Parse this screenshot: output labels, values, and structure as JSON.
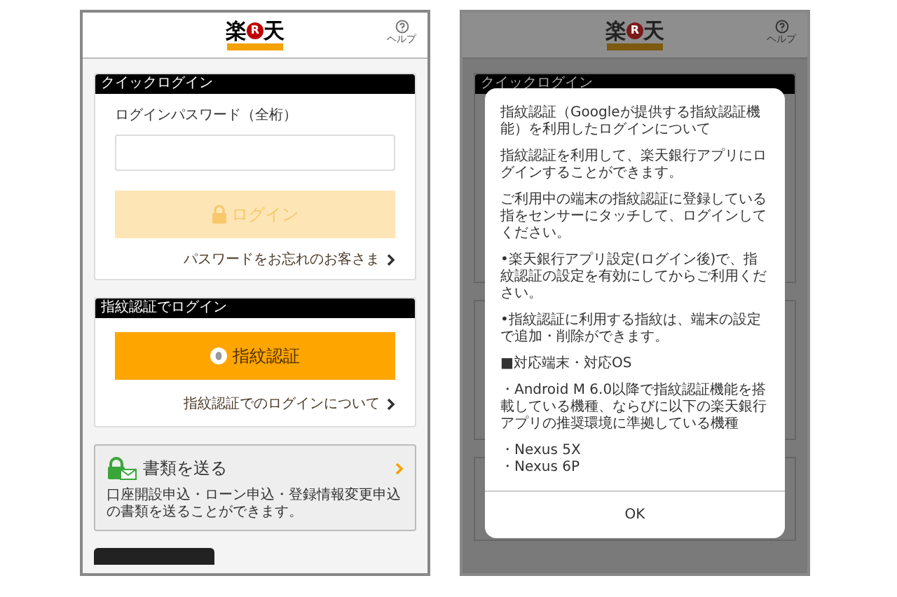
{
  "screens": [
    {
      "kind": "main",
      "header": {
        "logo_left": "楽",
        "logo_mark": "R",
        "logo_right": "天",
        "help": "ヘルプ"
      },
      "sections": [
        {
          "kind": "password",
          "heading": "クイックログイン",
          "label": "ログインパスワード（全桁）",
          "button": {
            "label": "ログイン",
            "disabled": true
          },
          "link": "パスワードをお忘れのお客さま"
        },
        {
          "kind": "fingerprint",
          "heading": "指紋認証でログイン",
          "button": {
            "label": "指紋認証",
            "disabled": false
          },
          "link": "指紋認証でのログインについて"
        },
        {
          "kind": "documents",
          "title": "書類を送る",
          "description": "口座開設申込・ローン申込・登録情報変更申込の書類を送ることができます。"
        },
        {
          "kind": "cut_heading"
        }
      ]
    },
    {
      "kind": "dialog",
      "header": {
        "logo_left": "楽",
        "logo_mark": "R",
        "logo_right": "天",
        "help": "ヘルプ"
      },
      "heading": "クイックログイン",
      "dialog": {
        "paragraphs": [
          "指紋認証（Googleが提供する指紋認証機能）を利用したログインについて",
          "指紋認証を利用して、楽天銀行アプリにログインすることができます。",
          "ご利用中の端末の指紋認証に登録している指をセンサーにタッチして、ログインしてください。",
          "•楽天銀行アプリ設定(ログイン後)で、指紋認証の設定を有効にしてからご利用ください。",
          "•指紋認証に利用する指紋は、端末の設定で追加・削除ができます。",
          "■対応端末・対応OS",
          "・Android M 6.0以降で指紋認証機能を搭載している機種、ならびに以下の楽天銀行アプリの推奨環境に準拠している機種"
        ],
        "devices": [
          "・Nexus 5X",
          "・Nexus 6P"
        ],
        "button": "OK"
      }
    }
  ]
}
